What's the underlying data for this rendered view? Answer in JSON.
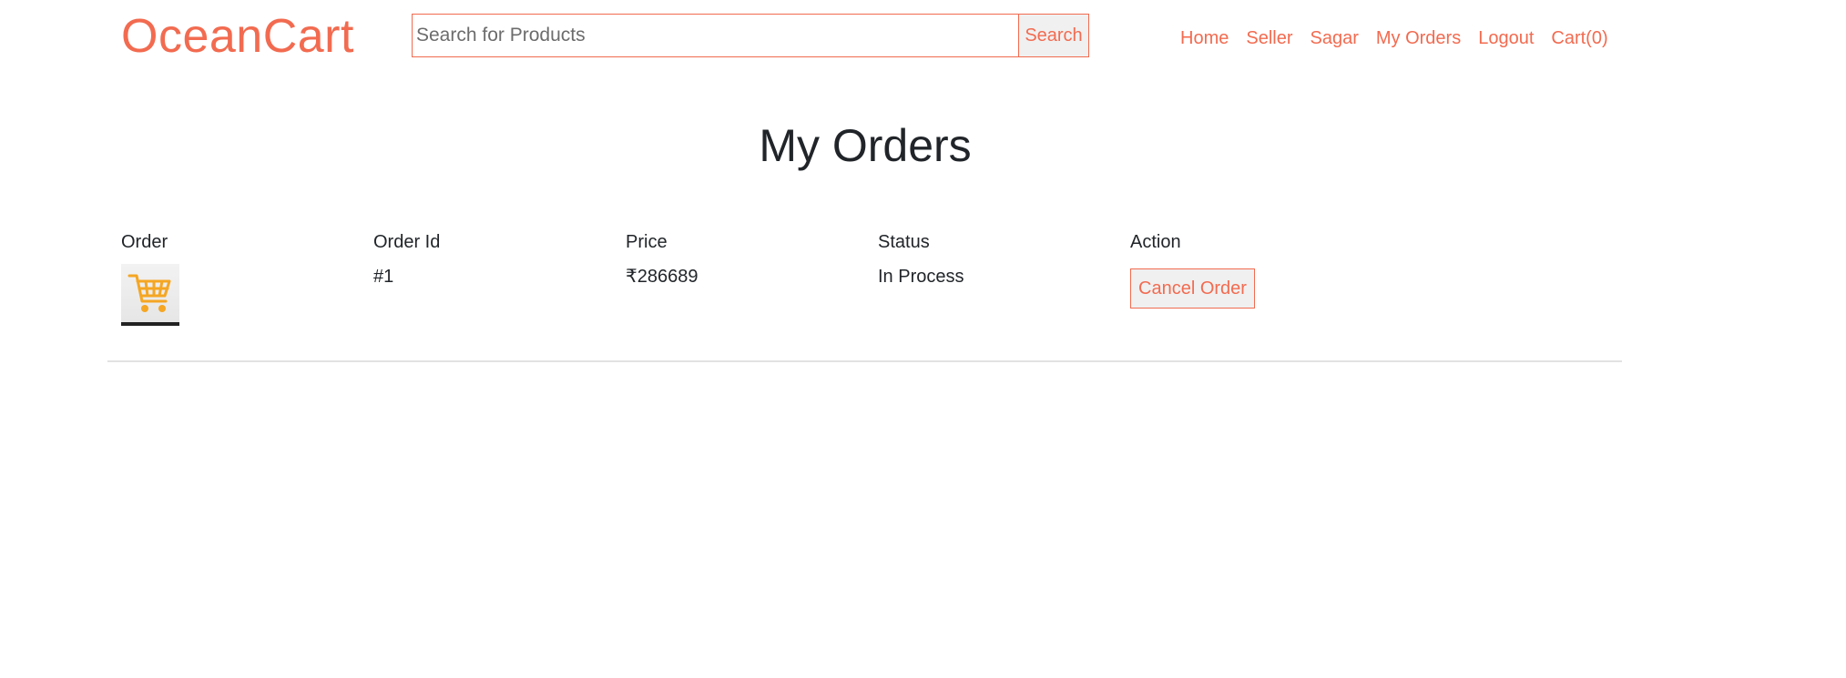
{
  "header": {
    "logo": "OceanCart",
    "search": {
      "placeholder": "Search for Products",
      "value": "",
      "button_label": "Search"
    },
    "nav": [
      "Home",
      "Seller",
      "Sagar",
      "My Orders",
      "Logout",
      "Cart(0)"
    ]
  },
  "main": {
    "title": "My Orders",
    "table": {
      "headers": [
        "Order",
        "Order Id",
        "Price",
        "Status",
        "Action"
      ],
      "rows": [
        {
          "image_icon": "shopping-cart-icon",
          "order_id": "#1",
          "price": "₹286689",
          "status": "In Process",
          "action_label": "Cancel Order"
        }
      ]
    }
  },
  "colors": {
    "accent": "#f26b50",
    "cart_icon": "#f5a623",
    "text": "#212529",
    "row_border": "#e2e2e2"
  }
}
